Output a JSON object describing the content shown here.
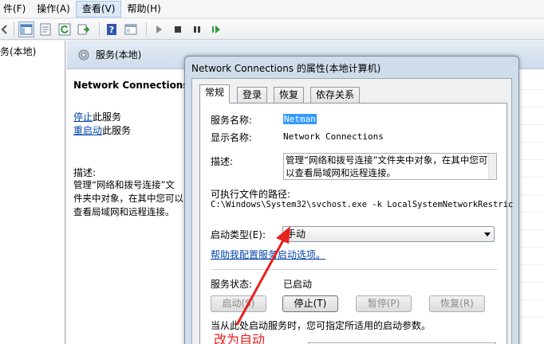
{
  "menubar": {
    "items": [
      {
        "label": "件(F)"
      },
      {
        "label": "操作(A)"
      },
      {
        "label": "查看(V)"
      },
      {
        "label": "帮助(H)"
      }
    ]
  },
  "tree": {
    "root_label": "务(本地)"
  },
  "pane": {
    "header_title": "服务(本地)",
    "detail": {
      "service_title": "Network Connections",
      "stop_link": "停止",
      "stop_suffix": "此服务",
      "restart_link": "重启动",
      "restart_suffix": "此服务",
      "desc_label": "描述:",
      "desc_text": "管理“网络和拨号连接”文件夹中对象，在其中您可以查看局域网和远程连接。"
    }
  },
  "dialog": {
    "title": "Network Connections 的属性(本地计算机)",
    "tabs": [
      {
        "label": "常规"
      },
      {
        "label": "登录"
      },
      {
        "label": "恢复"
      },
      {
        "label": "依存关系"
      }
    ],
    "general": {
      "service_name_label": "服务名称:",
      "service_name_value": "Netman",
      "display_name_label": "显示名称:",
      "display_name_value": "Network Connections",
      "description_label": "描述:",
      "description_value": "管理“网络和拨号连接”文件夹中对象，在其中您可以查看局域网和远程连接。",
      "exe_path_label": "可执行文件的路径:",
      "exe_path_value": "C:\\Windows\\System32\\svchost.exe -k LocalSystemNetworkRestric",
      "startup_type_label": "启动类型(E):",
      "startup_type_value": "手动",
      "help_link": "帮助我配置服务启动选项。",
      "status_label": "服务状态:",
      "status_value": "已启动",
      "start_button": "启动(S)",
      "stop_button": "停止(T)",
      "pause_button": "暂停(P)",
      "resume_button": "恢复(R)",
      "hint": "当从此处启动服务时，您可指定所适用的启动参数。"
    }
  },
  "annotation": {
    "text": "改为自动",
    "color": "#e8201e"
  }
}
